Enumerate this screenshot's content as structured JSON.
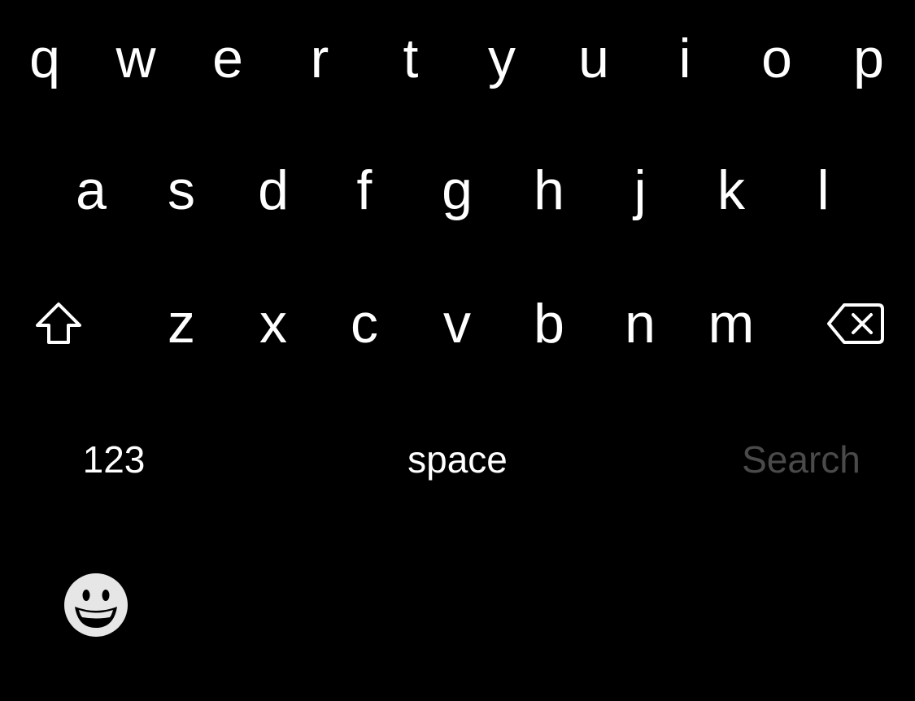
{
  "keyboard": {
    "row1": [
      "q",
      "w",
      "e",
      "r",
      "t",
      "y",
      "u",
      "i",
      "o",
      "p"
    ],
    "row2": [
      "a",
      "s",
      "d",
      "f",
      "g",
      "h",
      "j",
      "k",
      "l"
    ],
    "row3": [
      "z",
      "x",
      "c",
      "v",
      "b",
      "n",
      "m"
    ],
    "shift_icon": "shift-arrow-icon",
    "delete_icon": "backspace-icon",
    "numbers_label": "123",
    "space_label": "space",
    "search_label": "Search",
    "emoji_icon": "grinning-face-icon"
  },
  "colors": {
    "background": "#000000",
    "key_text": "#ffffff",
    "search_disabled": "#4a4a4a",
    "emoji_face": "#e6e6e6"
  }
}
